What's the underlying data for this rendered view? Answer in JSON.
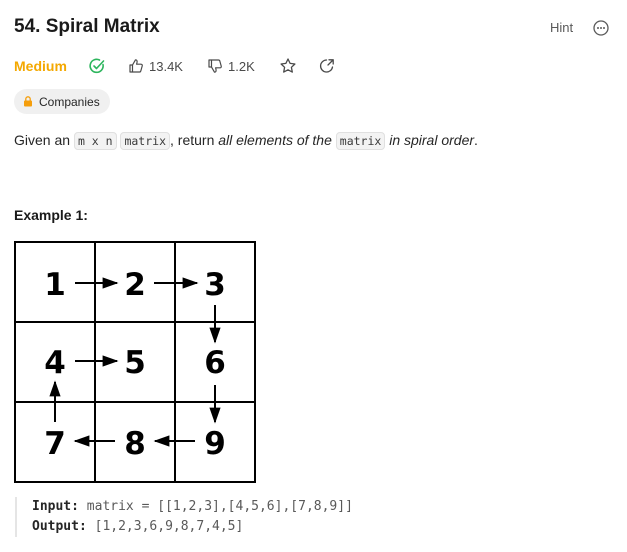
{
  "problem": {
    "title": "54. Spiral Matrix",
    "hint_label": "Hint",
    "difficulty": "Medium",
    "likes": "13.4K",
    "dislikes": "1.2K",
    "companies_label": "Companies"
  },
  "description": {
    "prefix": "Given an ",
    "code_m": "m x n",
    "code_matrix": "matrix",
    "middle": ", return ",
    "italic1": "all elements of the",
    "code_matrix2": "matrix",
    "italic2": "in spiral order",
    "suffix": "."
  },
  "example": {
    "title": "Example 1:",
    "matrix": [
      "1",
      "2",
      "3",
      "4",
      "5",
      "6",
      "7",
      "8",
      "9"
    ],
    "input_label": "Input:",
    "input_value": "matrix = [[1,2,3],[4,5,6],[7,8,9]]",
    "output_label": "Output:",
    "output_value": "[1,2,3,6,9,8,7,4,5]"
  },
  "colors": {
    "difficulty": "#f4a800",
    "solved": "#2db55d",
    "lock": "#f59e0b"
  },
  "icons": [
    "more-icon",
    "solved-check-icon",
    "thumbs-up-icon",
    "thumbs-down-icon",
    "star-icon",
    "share-icon",
    "lock-icon"
  ]
}
